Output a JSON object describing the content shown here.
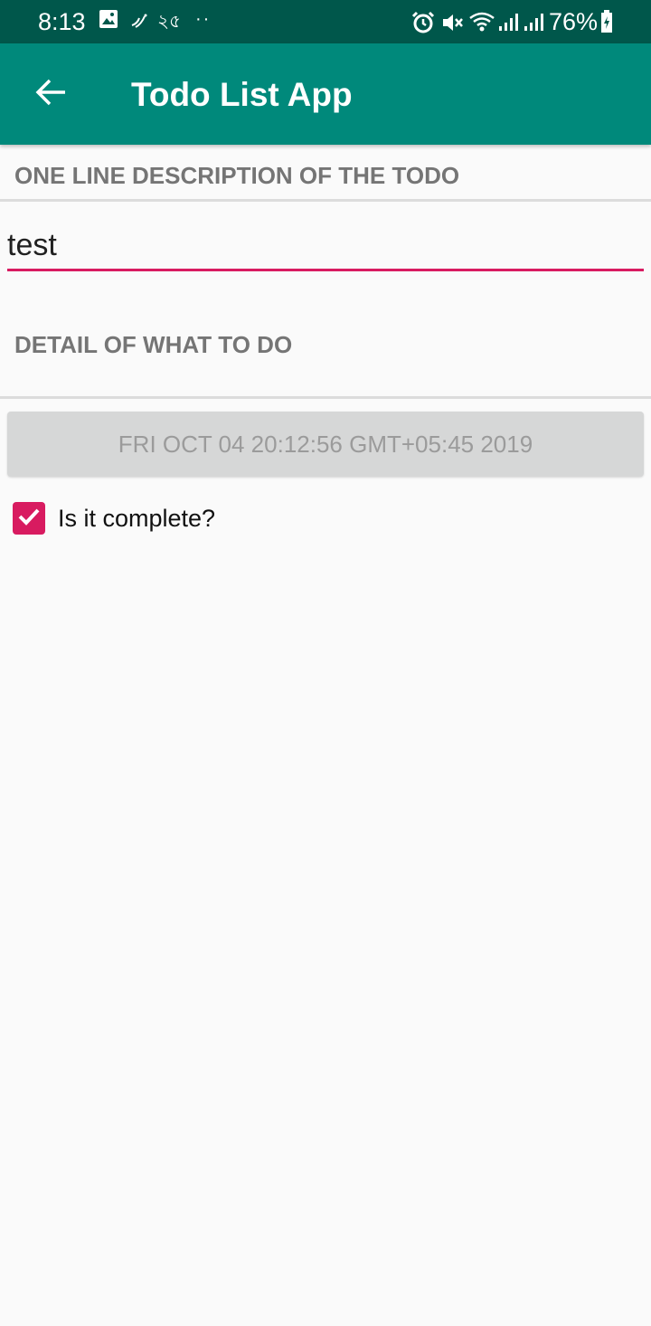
{
  "status_bar": {
    "time": "8:13",
    "extra_text": "২৫",
    "dots": "··",
    "battery_percent": "76%",
    "icons": [
      "image-icon",
      "signal-sparkle-icon",
      "alarm-icon",
      "mute-icon",
      "wifi-icon",
      "cell-signal-icon",
      "cell-signal-icon",
      "battery-icon"
    ]
  },
  "app_bar": {
    "back_icon": "arrow-back-icon",
    "title": "Todo List App"
  },
  "form": {
    "title_field": {
      "label": "ONE LINE DESCRIPTION OF THE TODO",
      "value": "test"
    },
    "detail_field": {
      "label": "DETAIL OF WHAT TO DO"
    },
    "date_button": {
      "label": "FRI OCT 04 20:12:56 GMT+05:45 2019"
    },
    "complete_checkbox": {
      "label": "Is it complete?",
      "checked": true
    }
  },
  "colors": {
    "status_bar": "#00574b",
    "app_bar": "#00897b",
    "accent": "#d81b60",
    "background": "#fafafa"
  }
}
